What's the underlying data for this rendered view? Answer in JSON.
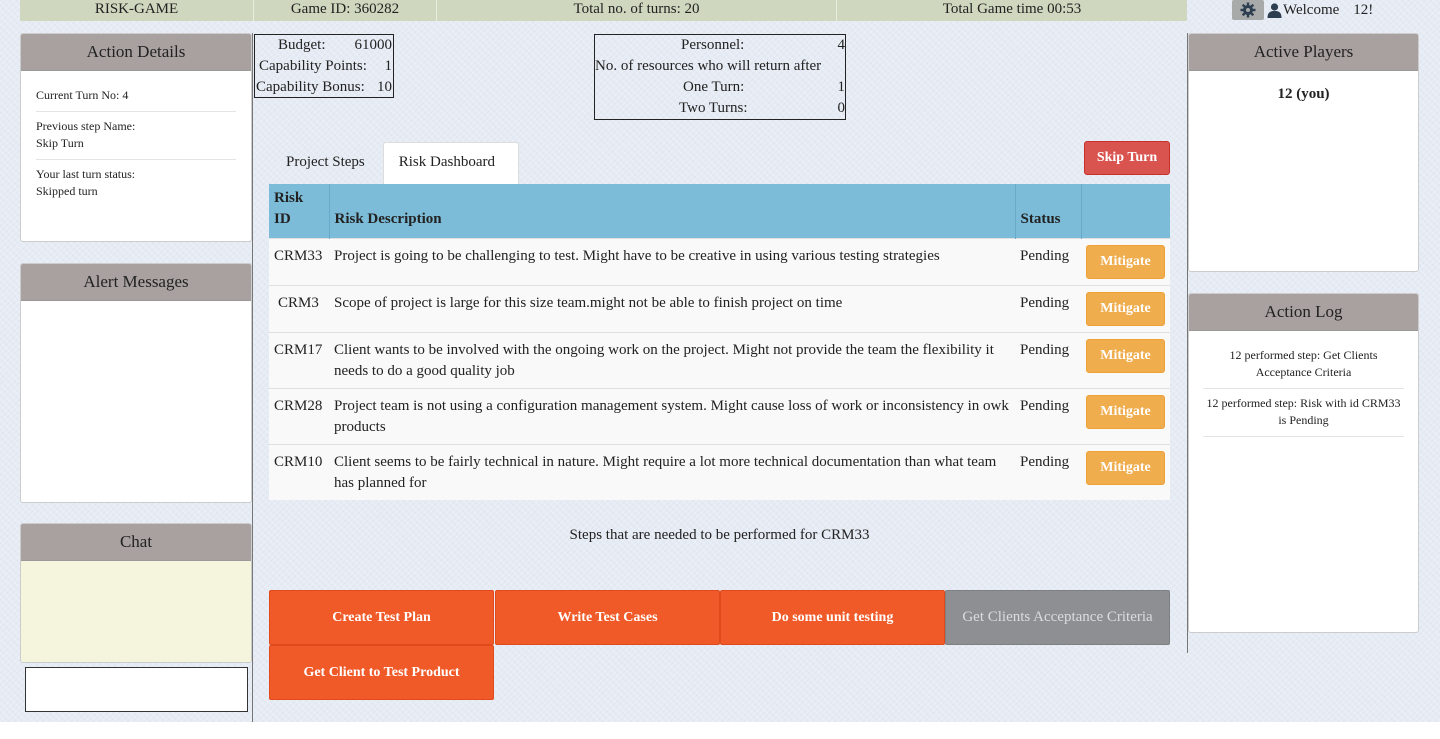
{
  "topbar": {
    "title": "RISK-GAME",
    "game_id": "Game ID: 360282",
    "turns": "Total no. of turns: 20",
    "time": "Total Game time 00:53"
  },
  "user": {
    "welcome": "Welcome",
    "name": "12!"
  },
  "action_details": {
    "heading": "Action Details",
    "current_turn": "Current Turn No: 4",
    "prev_step_label": "Previous step Name:",
    "prev_step_value": "Skip Turn",
    "last_status_label": "Your last turn status:",
    "last_status_value": "Skipped turn"
  },
  "alert_messages": {
    "heading": "Alert Messages"
  },
  "chat": {
    "heading": "Chat",
    "input_value": ""
  },
  "resources": {
    "budget_label": "Budget:",
    "budget_value": "61000",
    "cap_points_label": "Capability Points:",
    "cap_points_value": "1",
    "cap_bonus_label": "Capability Bonus:",
    "cap_bonus_value": "10",
    "personnel_label": "Personnel:",
    "personnel_value": "4",
    "return_label": "No. of resources who will return after",
    "one_turn_label": "One Turn:",
    "one_turn_value": "1",
    "two_turns_label": "Two Turns:",
    "two_turns_value": "0"
  },
  "tabs": [
    {
      "label": "Project Steps",
      "active": false
    },
    {
      "label": "Risk Dashboard",
      "active": true
    }
  ],
  "skip_turn_label": "Skip Turn",
  "table": {
    "headers": [
      "Risk ID",
      "Risk Description",
      "Status"
    ],
    "rows": [
      {
        "id": "CRM33",
        "desc": "Project is going to be challenging to test. Might have to be creative in using various testing strategies",
        "status": "Pending",
        "action": "Mitigate"
      },
      {
        "id": "CRM3",
        "desc": "Scope of project is large for this size team.might not be able to finish project on time",
        "status": "Pending",
        "action": "Mitigate"
      },
      {
        "id": "CRM17",
        "desc": "Client wants to be involved with the ongoing work on the project. Might not provide the team the flexibility it needs to do a good quality job",
        "status": "Pending",
        "action": "Mitigate"
      },
      {
        "id": "CRM28",
        "desc": "Project team is not using a configuration management system. Might cause loss of work or inconsistency in owk products",
        "status": "Pending",
        "action": "Mitigate"
      },
      {
        "id": "CRM10",
        "desc": "Client seems to be fairly technical in nature. Might require a lot more technical documentation than what team has planned for",
        "status": "Pending",
        "action": "Mitigate"
      }
    ]
  },
  "steps_caption": "Steps that are needed to be performed for CRM33",
  "steps": [
    {
      "label": "Create Test Plan",
      "done": false
    },
    {
      "label": "Write Test Cases",
      "done": false
    },
    {
      "label": "Do some unit testing",
      "done": false
    },
    {
      "label": "Get Clients Acceptance Criteria",
      "done": true
    },
    {
      "label": "Get Client to Test Product",
      "done": false
    }
  ],
  "active_players": {
    "heading": "Active Players",
    "player": "12 (you)"
  },
  "action_log": {
    "heading": "Action Log",
    "entries": [
      "12 performed step: Get Clients Acceptance Criteria",
      "12 performed step: Risk with id CRM33 is Pending"
    ]
  },
  "colors": {
    "header_bar": "#cfd8bf",
    "panel_header": "#a8a19f",
    "table_header": "#7cbcd8",
    "skip_button": "#d9534f",
    "mitigate_button": "#f0ad4e",
    "step_button": "#f05a28",
    "step_done": "#8d8f93"
  },
  "icons": {
    "settings": "gear-icon",
    "user": "user-icon"
  }
}
